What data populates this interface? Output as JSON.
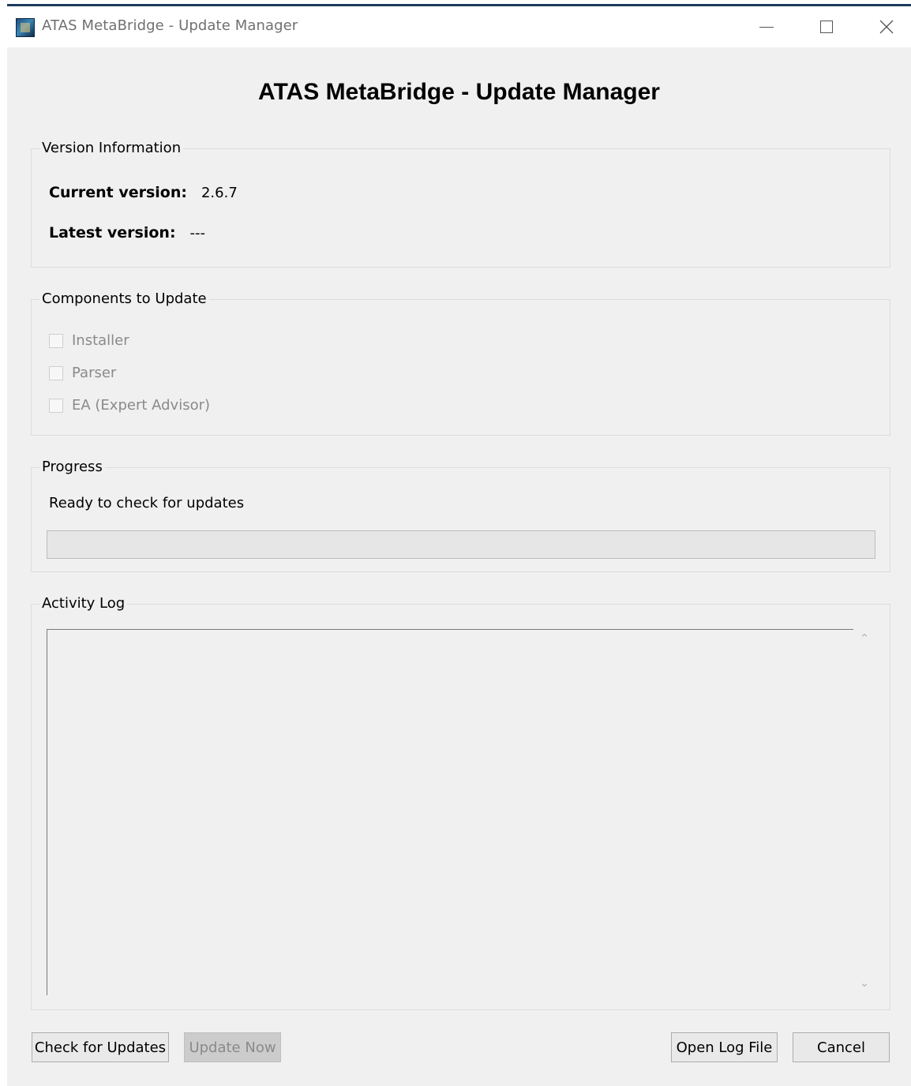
{
  "window": {
    "title": "ATAS MetaBridge - Update Manager",
    "controls": {
      "minimize_icon": "minimize-icon",
      "maximize_icon": "maximize-icon",
      "close_icon": "close-icon"
    }
  },
  "heading": "ATAS MetaBridge - Update Manager",
  "version_info": {
    "group_label": "Version Information",
    "current_label": "Current version:",
    "current_value": "2.6.7",
    "latest_label": "Latest version:",
    "latest_value": "---"
  },
  "components": {
    "group_label": "Components to Update",
    "items": [
      {
        "label": "Installer",
        "checked": false,
        "enabled": false
      },
      {
        "label": "Parser",
        "checked": false,
        "enabled": false
      },
      {
        "label": "EA (Expert Advisor)",
        "checked": false,
        "enabled": false
      }
    ]
  },
  "progress": {
    "group_label": "Progress",
    "status": "Ready to check for updates",
    "value": 0
  },
  "activity_log": {
    "group_label": "Activity Log",
    "content": ""
  },
  "buttons": {
    "check_updates": "Check for Updates",
    "update_now": "Update Now",
    "open_log": "Open Log File",
    "cancel": "Cancel"
  },
  "colors": {
    "title_bar_accent": "#1d3a5c",
    "window_bg": "#f0f0f0"
  }
}
